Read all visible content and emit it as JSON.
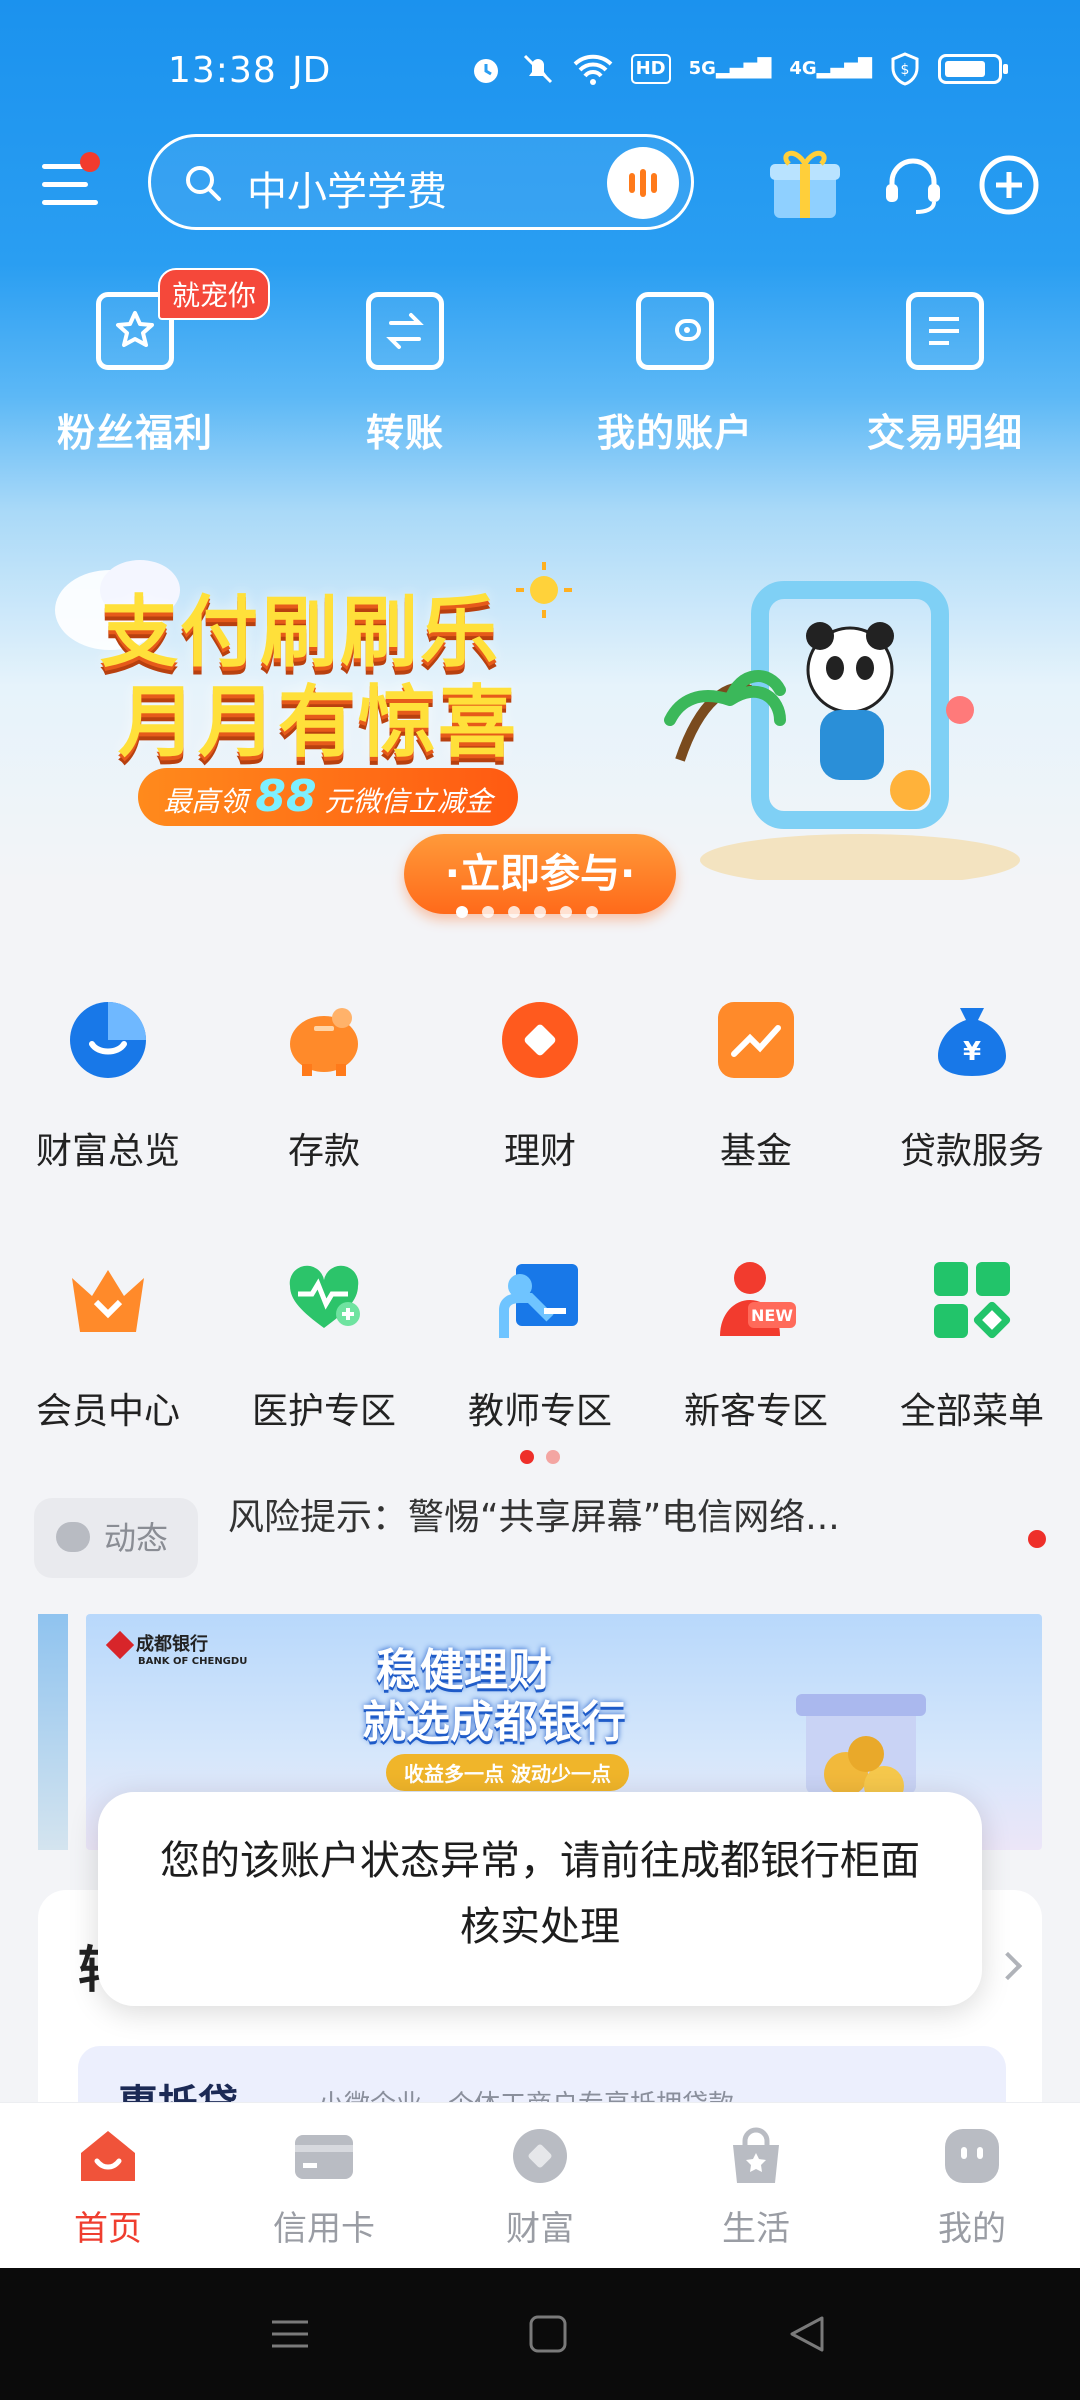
{
  "status_bar": {
    "time": "13:38",
    "carrier": "JD",
    "hd_label": "HD",
    "net1": "5G",
    "net2": "4G"
  },
  "search": {
    "placeholder": "中小学学费"
  },
  "quick_actions": [
    {
      "label": "粉丝福利",
      "badge": "就宠你"
    },
    {
      "label": "转账"
    },
    {
      "label": "我的账户"
    },
    {
      "label": "交易明细"
    }
  ],
  "banner": {
    "line1": "支付刷刷乐",
    "line2": "月月有惊喜",
    "sub_prefix": "最高领",
    "sub_amount": "88",
    "sub_suffix": "元微信立减金",
    "cta": "·立即参与·"
  },
  "menu_row1": [
    {
      "label": "财富总览",
      "icon": "wealth-overview-icon"
    },
    {
      "label": "存款",
      "icon": "piggy-bank-icon"
    },
    {
      "label": "理财",
      "icon": "finance-icon"
    },
    {
      "label": "基金",
      "icon": "fund-chart-icon"
    },
    {
      "label": "贷款服务",
      "icon": "money-bag-icon"
    }
  ],
  "menu_row2": [
    {
      "label": "会员中心",
      "icon": "crown-icon"
    },
    {
      "label": "医护专区",
      "icon": "medical-icon"
    },
    {
      "label": "教师专区",
      "icon": "teacher-icon"
    },
    {
      "label": "新客专区",
      "icon": "new-customer-icon"
    },
    {
      "label": "全部菜单",
      "icon": "all-menu-icon"
    }
  ],
  "news": {
    "tag": "动态",
    "text": "风险提示：警惕“共享屏幕”电信网络..."
  },
  "ad": {
    "logo": "成都银行",
    "logo_en": "BANK OF CHENGDU",
    "headline1": "稳健理财",
    "headline2": "就选成都银行",
    "slogan": "收益多一点 波动少一点"
  },
  "card": {
    "title": "转",
    "inner_name": "惠抵贷",
    "inner_desc": "小微企业、个体工商户专享抵押贷款"
  },
  "toast": {
    "message": "您的该账户状态异常，请前往成都银行柜面核实处理"
  },
  "tabs": [
    {
      "label": "首页",
      "active": true
    },
    {
      "label": "信用卡"
    },
    {
      "label": "财富"
    },
    {
      "label": "生活"
    },
    {
      "label": "我的"
    }
  ],
  "colors": {
    "primary_blue": "#1b92ee",
    "accent_red": "#ef3e2f",
    "orange": "#ff7a1a"
  }
}
